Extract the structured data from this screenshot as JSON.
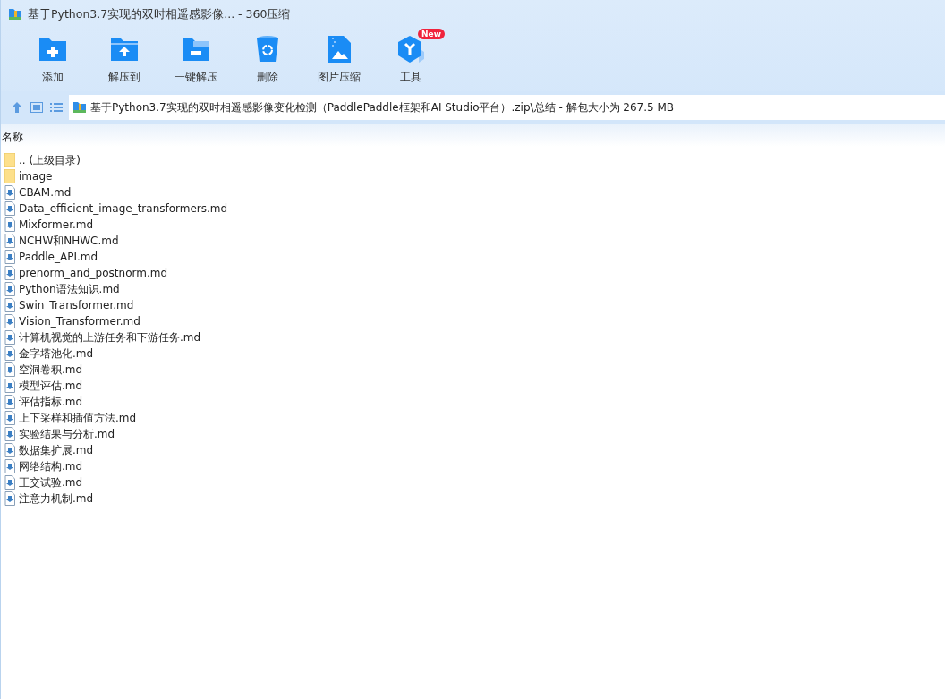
{
  "window": {
    "title": "基于Python3.7实现的双时相遥感影像... - 360压缩"
  },
  "toolbar": [
    {
      "kind": "add",
      "label": "添加"
    },
    {
      "kind": "extract",
      "label": "解压到"
    },
    {
      "kind": "oneclick",
      "label": "一键解压"
    },
    {
      "kind": "delete",
      "label": "删除"
    },
    {
      "kind": "image",
      "label": "图片压缩"
    },
    {
      "kind": "tools",
      "label": "工具",
      "badge": "New"
    }
  ],
  "address_bar": {
    "path": "基于Python3.7实现的双时相遥感影像变化检测（PaddlePaddle框架和AI Studio平台）.zip\\总结 - 解包大小为 267.5 MB"
  },
  "table": {
    "columns": [
      "名称"
    ],
    "rows": [
      {
        "kind": "folder",
        "name": ".. (上级目录)"
      },
      {
        "kind": "folder",
        "name": "image"
      },
      {
        "kind": "file",
        "name": "CBAM.md"
      },
      {
        "kind": "file",
        "name": "Data_efficient_image_transformers.md"
      },
      {
        "kind": "file",
        "name": "Mixformer.md"
      },
      {
        "kind": "file",
        "name": "NCHW和NHWC.md"
      },
      {
        "kind": "file",
        "name": "Paddle_API.md"
      },
      {
        "kind": "file",
        "name": "prenorm_and_postnorm.md"
      },
      {
        "kind": "file",
        "name": "Python语法知识.md"
      },
      {
        "kind": "file",
        "name": "Swin_Transformer.md"
      },
      {
        "kind": "file",
        "name": "Vision_Transformer.md"
      },
      {
        "kind": "file",
        "name": "计算机视觉的上游任务和下游任务.md"
      },
      {
        "kind": "file",
        "name": "金字塔池化.md"
      },
      {
        "kind": "file",
        "name": "空洞卷积.md"
      },
      {
        "kind": "file",
        "name": "模型评估.md"
      },
      {
        "kind": "file",
        "name": "评估指标.md"
      },
      {
        "kind": "file",
        "name": "上下采样和插值方法.md"
      },
      {
        "kind": "file",
        "name": "实验结果与分析.md"
      },
      {
        "kind": "file",
        "name": "数据集扩展.md"
      },
      {
        "kind": "file",
        "name": "网络结构.md"
      },
      {
        "kind": "file",
        "name": "正交试验.md"
      },
      {
        "kind": "file",
        "name": "注意力机制.md"
      }
    ]
  }
}
